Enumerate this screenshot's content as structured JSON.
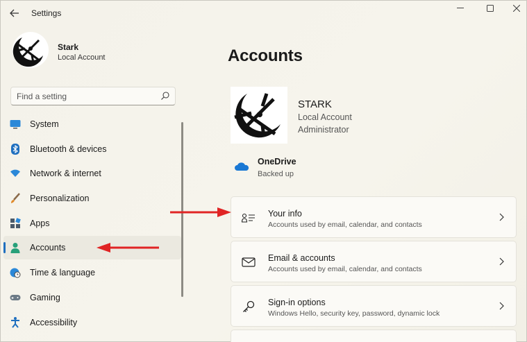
{
  "window": {
    "title": "Settings",
    "controls": {
      "minimize": "—",
      "maximize": "☐",
      "close": "✕"
    }
  },
  "profile": {
    "name": "Stark",
    "account_type": "Local Account"
  },
  "search": {
    "placeholder": "Find a setting"
  },
  "sidebar": {
    "items": [
      {
        "label": "System",
        "icon": "monitor-icon",
        "color": "#2b88d8"
      },
      {
        "label": "Bluetooth & devices",
        "icon": "bluetooth-icon",
        "color": "#1f6fbf"
      },
      {
        "label": "Network & internet",
        "icon": "wifi-icon",
        "color": "#2b88d8"
      },
      {
        "label": "Personalization",
        "icon": "brush-icon",
        "color": "#e08a2b"
      },
      {
        "label": "Apps",
        "icon": "apps-icon",
        "color": "#4a5a6a"
      },
      {
        "label": "Accounts",
        "icon": "person-icon",
        "color": "#27a07a",
        "selected": true
      },
      {
        "label": "Time & language",
        "icon": "globe-clock-icon",
        "color": "#2b88d8"
      },
      {
        "label": "Gaming",
        "icon": "gamepad-icon",
        "color": "#6c7a86"
      },
      {
        "label": "Accessibility",
        "icon": "accessibility-icon",
        "color": "#1f6fbf"
      }
    ]
  },
  "main": {
    "title": "Accounts",
    "account": {
      "name": "STARK",
      "type": "Local Account",
      "role": "Administrator"
    },
    "onedrive": {
      "title": "OneDrive",
      "status": "Backed up"
    },
    "cards": [
      {
        "title": "Your info",
        "description": "Accounts used by email, calendar, and contacts",
        "icon": "person-card-icon"
      },
      {
        "title": "Email & accounts",
        "description": "Accounts used by email, calendar, and contacts",
        "icon": "mail-icon"
      },
      {
        "title": "Sign-in options",
        "description": "Windows Hello, security key, password, dynamic lock",
        "icon": "key-icon"
      }
    ]
  },
  "annotation_color": "#e02424"
}
